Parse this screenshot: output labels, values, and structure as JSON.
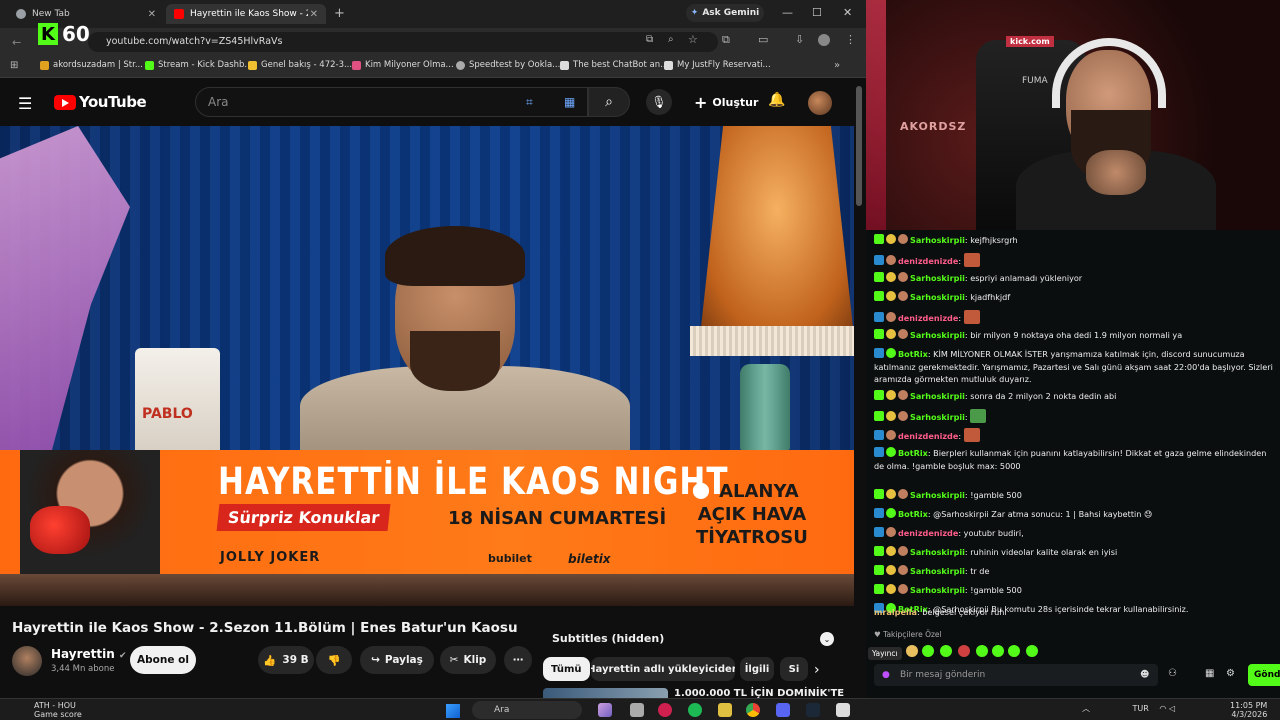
{
  "browser": {
    "tabs": [
      {
        "label": "New Tab"
      },
      {
        "label": "Hayrettin ile Kaos Show - 2.Sez"
      }
    ],
    "ask_gemini": "Ask Gemini",
    "url": "youtube.com/watch?v=ZS45HlvRaVs",
    "fps_overlay": "60",
    "bookmarks": [
      {
        "label": "akordsuzadam | Str...",
        "color": "#e0a020"
      },
      {
        "label": "Stream - Kick Dashb...",
        "color": "#53fc18"
      },
      {
        "label": "Genel bakış - 472-3...",
        "color": "#f0c030"
      },
      {
        "label": "Kim Milyoner Olma...",
        "color": "#e05080"
      },
      {
        "label": "Speedtest by Ookla...",
        "color": "#aaaaaa"
      },
      {
        "label": "The best ChatBot an...",
        "color": "#dddddd"
      },
      {
        "label": "My JustFly Reservati...",
        "color": "#dddddd"
      }
    ]
  },
  "youtube": {
    "logo": "YouTube",
    "search_placeholder": "Ara",
    "create_label": "Oluştur",
    "video": {
      "banner_title": "HAYRETTİN İLE KAOS NIGHT",
      "banner_surprise": "Sürpriz Konuklar",
      "banner_date": "18 NİSAN CUMARTESİ",
      "banner_venue_line1": "ALANYA",
      "banner_venue_line2": "AÇIK HAVA",
      "banner_venue_line3": "TİYATROSU",
      "banner_sponsor": "JOLLY JOKER",
      "banner_ticket1": "bubilet",
      "banner_ticket2": "biletix",
      "bag_text": "PABLO"
    },
    "title": "Hayrettin ile Kaos Show - 2.Sezon 11.Bölüm | Enes Batur'un Kaosu",
    "channel_name": "Hayrettin",
    "channel_subs": "3,44 Mn abone",
    "subscribe_label": "Abone ol",
    "like_count": "39 B",
    "share_label": "Paylaş",
    "clip_label": "Klip",
    "subtitles_header": "Subtitles (hidden)",
    "chips": [
      "Tümü",
      "Hayrettin adlı yükleyiciden",
      "İlgili",
      "Si"
    ],
    "rec_title": "1.000.000 TL İÇİN DOMİNİK'TE"
  },
  "stream": {
    "cam_logo": "AKORDSZ",
    "chair_text": "FUMA",
    "kick_badge": "kick.com",
    "chat": [
      {
        "user": "Sarhoskirpii",
        "text": "kejfhjksrgrh",
        "color": "#53fc18"
      },
      {
        "user": "denizdenizde",
        "text": "",
        "color": "#ff5c8a",
        "emote": true
      },
      {
        "user": "Sarhoskirpii",
        "text": "espriyi anlamadı yükleniyor",
        "color": "#53fc18"
      },
      {
        "user": "Sarhoskirpii",
        "text": "kjadfhkjdf",
        "color": "#53fc18"
      },
      {
        "user": "denizdenizde",
        "text": "",
        "color": "#ff5c8a",
        "emote": true
      },
      {
        "user": "Sarhoskirpii",
        "text": "bir milyon 9 noktaya oha dedi 1.9 milyon normali ya",
        "color": "#53fc18"
      },
      {
        "user": "BotRix",
        "text": "KİM MİLYONER OLMAK İSTER yarışmamıza katılmak için, discord sunucumuza katılmanız gerekmektedir. Yarışmamız, Pazartesi ve Salı günü akşam saat 22:00'da başlıyor. Sizleri aramızda görmekten mutluluk duyarız.",
        "color": "#53fc18",
        "bot": true
      },
      {
        "user": "Sarhoskirpii",
        "text": "sonra da 2 milyon 2 nokta dedin abi",
        "color": "#53fc18"
      },
      {
        "user": "Sarhoskirpii",
        "text": "",
        "color": "#53fc18",
        "emote": true
      },
      {
        "user": "denizdenizde",
        "text": "",
        "color": "#ff5c8a",
        "emote": true
      },
      {
        "user": "BotRix",
        "text": "Bierpleri kullanmak için puanını katlayabilirsin! Dikkat et gaza gelme elindekinden de olma. !gamble boşluk max: 5000",
        "color": "#53fc18",
        "bot": true
      },
      {
        "user": "Sarhoskirpii",
        "text": "!gamble 500",
        "color": "#53fc18"
      },
      {
        "user": "BotRix",
        "text": "@Sarhoskirpii Zar atma sonucu: 1 | Bahsi kaybettin 😓",
        "color": "#53fc18",
        "bot": true
      },
      {
        "user": "denizdenizde",
        "text": "youtubr budiri,",
        "color": "#ff5c8a"
      },
      {
        "user": "Sarhoskirpii",
        "text": "ruhinin videolar kalite olarak en iyisi",
        "color": "#53fc18"
      },
      {
        "user": "Sarhoskirpii",
        "text": "tr de",
        "color": "#53fc18"
      },
      {
        "user": "Sarhoskirpii",
        "text": "!gamble 500",
        "color": "#53fc18"
      },
      {
        "user": "BotRix",
        "text": "@Sarhoskirpii Bu komutu 28s içerisinde tekrar kullanabilirsiniz.",
        "color": "#53fc18",
        "bot": true
      },
      {
        "user": "mralpella",
        "text": "belgesel çekiyor ruhi",
        "color": "#e8c070",
        "plain": true
      }
    ],
    "followers_only": "Takipçilere Özel",
    "yayinci": "Yayıncı",
    "input_placeholder": "Bir mesaj gönderin",
    "send_label": "Gönde"
  },
  "taskbar": {
    "weather_line1": "ATH - HOU",
    "weather_line2": "Game score",
    "search_label": "Ara",
    "lang": "TUR",
    "time": "11:05 PM",
    "date": "4/3/2026"
  }
}
